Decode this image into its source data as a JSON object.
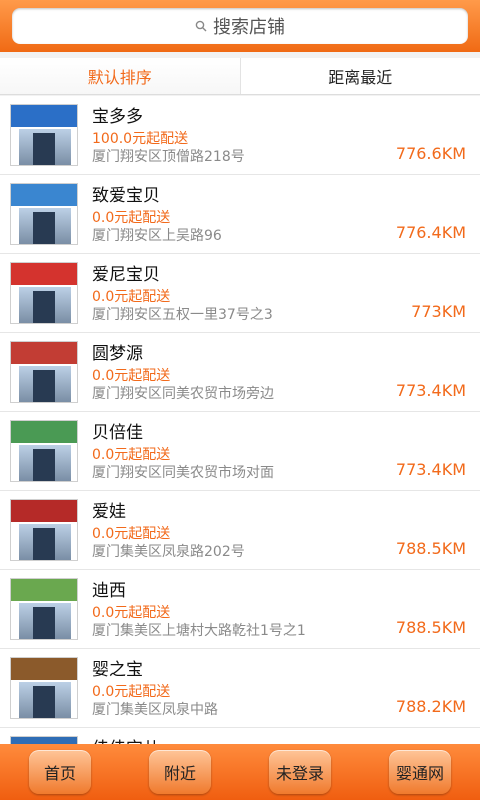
{
  "header": {
    "search_placeholder": "搜索店铺"
  },
  "tabs": [
    {
      "label": "默认排序",
      "active": true
    },
    {
      "label": "距离最近",
      "active": false
    }
  ],
  "stores": [
    {
      "name": "宝多多",
      "min_order": "100.0元起配送",
      "address": "厦门翔安区顶僧路218号",
      "distance": "776.6KM"
    },
    {
      "name": "致爱宝贝",
      "min_order": "0.0元起配送",
      "address": "厦门翔安区上吴路96",
      "distance": "776.4KM"
    },
    {
      "name": "爱尼宝贝",
      "min_order": "0.0元起配送",
      "address": "厦门翔安区五权一里37号之3",
      "distance": "773KM"
    },
    {
      "name": "圆梦源",
      "min_order": "0.0元起配送",
      "address": "厦门翔安区同美农贸市场旁边",
      "distance": "773.4KM"
    },
    {
      "name": "贝倍佳",
      "min_order": "0.0元起配送",
      "address": "厦门翔安区同美农贸市场对面",
      "distance": "773.4KM"
    },
    {
      "name": "爱娃",
      "min_order": "0.0元起配送",
      "address": "厦门集美区凤泉路202号",
      "distance": "788.5KM"
    },
    {
      "name": "迪西",
      "min_order": "0.0元起配送",
      "address": "厦门集美区上塘村大路乾社1号之1",
      "distance": "788.5KM"
    },
    {
      "name": "婴之宝",
      "min_order": "0.0元起配送",
      "address": "厦门集美区凤泉中路",
      "distance": "788.2KM"
    },
    {
      "name": "佳佳宝儿",
      "min_order": "",
      "address": "",
      "distance": ""
    }
  ],
  "footer": [
    {
      "label": "首页"
    },
    {
      "label": "附近"
    },
    {
      "label": "未登录"
    },
    {
      "label": "婴通网"
    }
  ],
  "colors": {
    "accent": "#f26a1b",
    "header": "#f57a28"
  }
}
